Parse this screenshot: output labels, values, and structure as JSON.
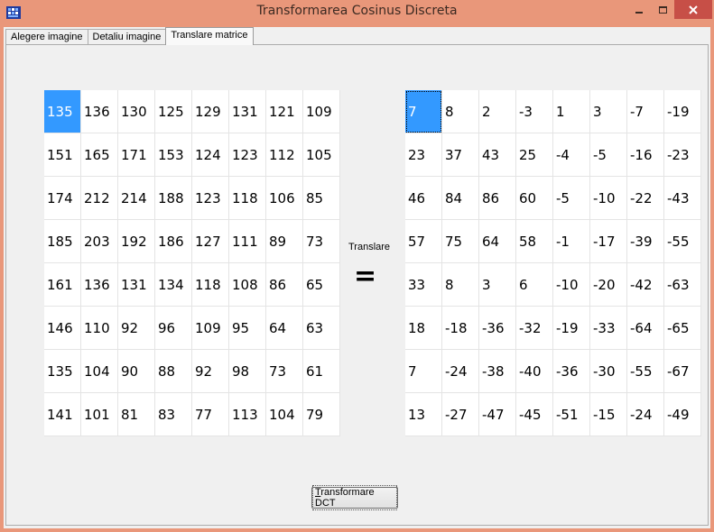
{
  "window": {
    "title": "Transformarea Cosinus Discreta",
    "controls": {
      "minimize": "minimize-icon",
      "maximize": "maximize-icon",
      "close": "close-icon"
    },
    "colors": {
      "titlebar": "#e9977a",
      "close": "#c74f47",
      "selection": "#3399ff"
    }
  },
  "tabs": [
    {
      "label": "Alegere imagine",
      "active": false
    },
    {
      "label": "Detaliu imagine",
      "active": false
    },
    {
      "label": "Translare matrice",
      "active": true
    }
  ],
  "operation": {
    "label": "Translare",
    "symbol": "="
  },
  "left_matrix": {
    "selected": [
      0,
      0
    ],
    "rows": [
      [
        "135",
        "136",
        "130",
        "125",
        "129",
        "131",
        "121",
        "109"
      ],
      [
        "151",
        "165",
        "171",
        "153",
        "124",
        "123",
        "112",
        "105"
      ],
      [
        "174",
        "212",
        "214",
        "188",
        "123",
        "118",
        "106",
        "85"
      ],
      [
        "185",
        "203",
        "192",
        "186",
        "127",
        "111",
        "89",
        "73"
      ],
      [
        "161",
        "136",
        "131",
        "134",
        "118",
        "108",
        "86",
        "65"
      ],
      [
        "146",
        "110",
        "92",
        "96",
        "109",
        "95",
        "64",
        "63"
      ],
      [
        "135",
        "104",
        "90",
        "88",
        "92",
        "98",
        "73",
        "61"
      ],
      [
        "141",
        "101",
        "81",
        "83",
        "77",
        "113",
        "104",
        "79"
      ]
    ]
  },
  "right_matrix": {
    "selected": [
      0,
      0
    ],
    "rows": [
      [
        "7",
        "8",
        "2",
        "-3",
        "1",
        "3",
        "-7",
        "-19"
      ],
      [
        "23",
        "37",
        "43",
        "25",
        "-4",
        "-5",
        "-16",
        "-23"
      ],
      [
        "46",
        "84",
        "86",
        "60",
        "-5",
        "-10",
        "-22",
        "-43"
      ],
      [
        "57",
        "75",
        "64",
        "58",
        "-1",
        "-17",
        "-39",
        "-55"
      ],
      [
        "33",
        "8",
        "3",
        "6",
        "-10",
        "-20",
        "-42",
        "-63"
      ],
      [
        "18",
        "-18",
        "-36",
        "-32",
        "-19",
        "-33",
        "-64",
        "-65"
      ],
      [
        "7",
        "-24",
        "-38",
        "-40",
        "-36",
        "-30",
        "-55",
        "-67"
      ],
      [
        "13",
        "-27",
        "-47",
        "-45",
        "-51",
        "-15",
        "-24",
        "-49"
      ]
    ]
  },
  "button": {
    "mnemonic": "T",
    "rest": "ransformare DCT"
  }
}
